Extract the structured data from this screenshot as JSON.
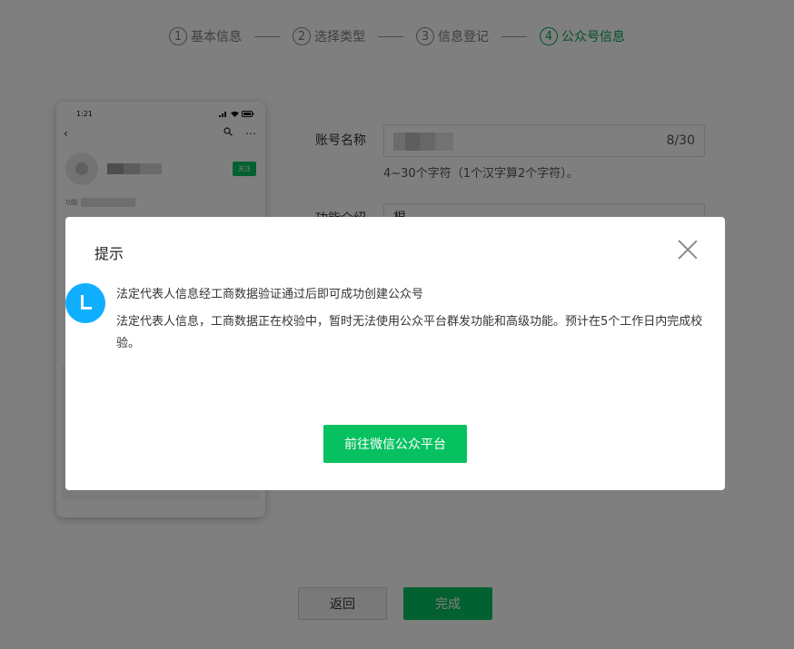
{
  "steps": [
    {
      "num": "1",
      "label": "基本信息"
    },
    {
      "num": "2",
      "label": "选择类型"
    },
    {
      "num": "3",
      "label": "信息登记"
    },
    {
      "num": "4",
      "label": "公众号信息"
    }
  ],
  "phone": {
    "time": "1:21",
    "follow_label": "关注",
    "intro_label": "功能"
  },
  "form": {
    "name_label": "账号名称",
    "name_count": "8/30",
    "name_hint": "4~30个字符（1个汉字算2个字符）。",
    "intro_label": "功能介绍",
    "intro_value": "根"
  },
  "footer": {
    "back_label": "返回",
    "done_label": "完成"
  },
  "dialog": {
    "title": "提示",
    "message_title": "法定代表人信息经工商数据验证通过后即可成功创建公众号",
    "message_body": "法定代表人信息，工商数据正在校验中，暂时无法使用公众平台群发功能和高级功能。预计在5个工作日内完成校验。",
    "button_label": "前往微信公众平台"
  },
  "colors": {
    "accent": "#07c160",
    "info_icon": "#10aeff"
  }
}
